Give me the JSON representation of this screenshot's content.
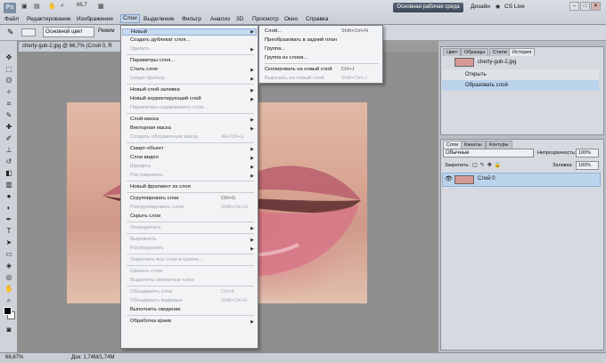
{
  "app": {
    "logo": "Ps",
    "zoom": "66,7",
    "workspace_button": "Основная рабочая среда",
    "design": "Дизайн",
    "cslive": "CS Live"
  },
  "menubar": [
    "Файл",
    "Редактирование",
    "Изображение",
    "Слои",
    "Выделение",
    "Фильтр",
    "Анализ",
    "3D",
    "Просмотр",
    "Окно",
    "Справка"
  ],
  "options": {
    "combo": "Основной цвет",
    "mode_label": "Режим"
  },
  "document": {
    "tab": "cherty-gub-2.jpg @ 66,7% (Слой 0, R",
    "status_zoom": "66,67%",
    "status_doc": "Док: 1,74М/1,74М"
  },
  "layer_menu": {
    "items": [
      {
        "label": "Новый",
        "arrow": true,
        "highlighted": true
      },
      {
        "label": "Создать дубликат слоя..."
      },
      {
        "label": "Удалить",
        "arrow": true,
        "disabled": true
      },
      {
        "label": "Параметры слоя..."
      },
      {
        "label": "Стиль слоя",
        "arrow": true
      },
      {
        "label": "Смарт-фильтр",
        "arrow": true,
        "disabled": true
      },
      {
        "label": "Новый слой-заливка",
        "arrow": true
      },
      {
        "label": "Новый корректирующий слой",
        "arrow": true
      },
      {
        "label": "Параметры содержимого слоя...",
        "disabled": true
      },
      {
        "label": "Слой-маска",
        "arrow": true
      },
      {
        "label": "Векторная маска",
        "arrow": true
      },
      {
        "label": "Создать обтравочную маску",
        "shortcut": "Alt+Ctrl+G",
        "disabled": true
      },
      {
        "label": "Смарт-объект",
        "arrow": true
      },
      {
        "label": "Слои видео",
        "arrow": true
      },
      {
        "label": "Шрифты",
        "arrow": true,
        "disabled": true
      },
      {
        "label": "Растрировать",
        "arrow": true,
        "disabled": true
      },
      {
        "label": "Новый фрагмент из слоя"
      },
      {
        "label": "Сгруппировать слои",
        "shortcut": "Ctrl+G"
      },
      {
        "label": "Разгруппировать слои",
        "shortcut": "Shift+Ctrl+G",
        "disabled": true
      },
      {
        "label": "Скрыть слои"
      },
      {
        "label": "Упорядочить",
        "arrow": true,
        "disabled": true
      },
      {
        "label": "Выровнять",
        "arrow": true,
        "disabled": true
      },
      {
        "label": "Распределить",
        "arrow": true,
        "disabled": true
      },
      {
        "label": "Закрепить все слои в группе...",
        "disabled": true
      },
      {
        "label": "Связать слои",
        "disabled": true
      },
      {
        "label": "Выделить связанные слои",
        "disabled": true
      },
      {
        "label": "Объединить слои",
        "shortcut": "Ctrl+E",
        "disabled": true
      },
      {
        "label": "Объединить видимые",
        "shortcut": "Shift+Ctrl+E",
        "disabled": true
      },
      {
        "label": "Выполнить сведение"
      },
      {
        "label": "Обработка краев",
        "arrow": true
      }
    ]
  },
  "submenu": {
    "items": [
      {
        "label": "Слой...",
        "shortcut": "Shift+Ctrl+N"
      },
      {
        "label": "Преобразовать в задний план"
      },
      {
        "label": "Группа..."
      },
      {
        "label": "Группа из слоев..."
      },
      {
        "label": "Скопировать на новый слой",
        "shortcut": "Ctrl+J"
      },
      {
        "label": "Вырезать на новый слой",
        "shortcut": "Shift+Ctrl+J",
        "disabled": true
      }
    ]
  },
  "history_panel": {
    "tabs": [
      "Цвет",
      "Образцы",
      "Стили",
      "История"
    ],
    "snapshot": "cherty-gub-2.jpg",
    "rows": [
      "Открыть",
      "Образовать слой"
    ]
  },
  "layers_panel": {
    "tabs": [
      "Слои",
      "Каналы",
      "Контуры"
    ],
    "blend_mode": "Обычные",
    "opacity_label": "Непрозрачность:",
    "opacity_value": "100%",
    "lock_label": "Закрепить:",
    "fill_label": "Заливка:",
    "fill_value": "100%",
    "layer_name": "Слой 0"
  }
}
